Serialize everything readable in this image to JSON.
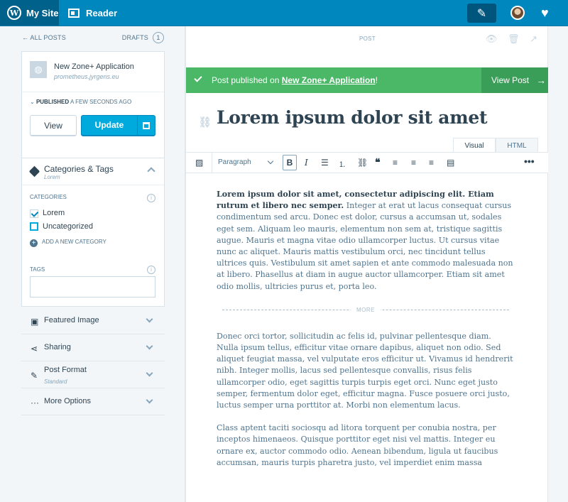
{
  "masterbar": {
    "my_site": "My Site",
    "reader": "Reader"
  },
  "sidebar": {
    "all_posts": "ALL POSTS",
    "drafts": "DRAFTS",
    "drafts_count": "1",
    "site_name": "New Zone+ Application",
    "site_url": "prometheus.jyrgens.eu",
    "published_label": "PUBLISHED",
    "published_time": "A FEW SECONDS AGO",
    "view_button": "View",
    "update_button": "Update",
    "categories_tags": {
      "title": "Categories & Tags",
      "subtitle": "Lorem",
      "categories_label": "CATEGORIES",
      "categories": [
        {
          "label": "Lorem",
          "checked": true
        },
        {
          "label": "Uncategorized",
          "checked": false
        }
      ],
      "add_category": "ADD A NEW CATEGORY",
      "tags_label": "TAGS",
      "tags_value": ""
    },
    "sections": [
      {
        "label": "Featured Image",
        "subtitle": "",
        "icon": "image-icon"
      },
      {
        "label": "Sharing",
        "subtitle": "",
        "icon": "share-icon"
      },
      {
        "label": "Post Format",
        "subtitle": "Standard",
        "icon": "format-icon"
      },
      {
        "label": "More Options",
        "subtitle": "",
        "icon": "ellipsis-icon"
      }
    ]
  },
  "editor": {
    "post_label": "POST",
    "notice": {
      "prefix": "Post published on ",
      "link": "New Zone+ Application",
      "suffix": "!",
      "action": "View Post"
    },
    "title": "Lorem ipsum dolor sit amet",
    "tabs": [
      "Visual",
      "HTML"
    ],
    "format_select": "Paragraph",
    "more_label": "MORE",
    "paragraphs": {
      "p1_bold": "Lorem ipsum dolor sit amet, consectetur adipiscing elit. Etiam rutrum et libero nec semper.",
      "p1_rest": " Integer at erat ut lacus consequat cursus condimentum sed arcu. Donec est dolor, cursus a accumsan ut, sodales eget sem. Aliquam leo mauris, elementum non sem at, tristique sagittis augue. Mauris et magna vitae odio ullamcorper luctus. Ut cursus vitae nunc ac aliquet. Mauris mattis vestibulum orci, nec tincidunt tellus ultrices quis. Vestibulum sit amet sapien et ante commodo malesuada non at libero. Phasellus at diam in augue auctor ullamcorper. Etiam sit amet odio mollis, ultricies purus et, porta leo.",
      "p2": "Donec orci tortor, sollicitudin ac felis id, pulvinar pellentesque diam. Nulla ipsum tellus, efficitur vitae ornare dapibus, aliquet non odio. Sed aliquet feugiat massa, vel vulputate eros efficitur ut. Vivamus id hendrerit nibh. Integer mollis, lacus sed pellentesque convallis, risus felis ullamcorper odio, eget sagittis turpis turpis eget orci. Nunc eget justo semper, fermentum dolor eget, efficitur magna. Fusce posuere orci justo, luctus semper urna porttitor at. Morbi non elementum lacus.",
      "p3": "Class aptent taciti sociosqu ad litora torquent per conubia nostra, per inceptos himenaeos. Quisque porttitor eget nisi vel mattis. Integer eu ornare ex, auctor commodo odio. Aenean bibendum, ligula ut faucibus accumsan, mauris turpis pharetra justo, vel imperdiet enim massa"
    }
  },
  "colors": {
    "masterbar": "#0087be",
    "notice": "#4ab866",
    "primary_button": "#00aadc"
  }
}
